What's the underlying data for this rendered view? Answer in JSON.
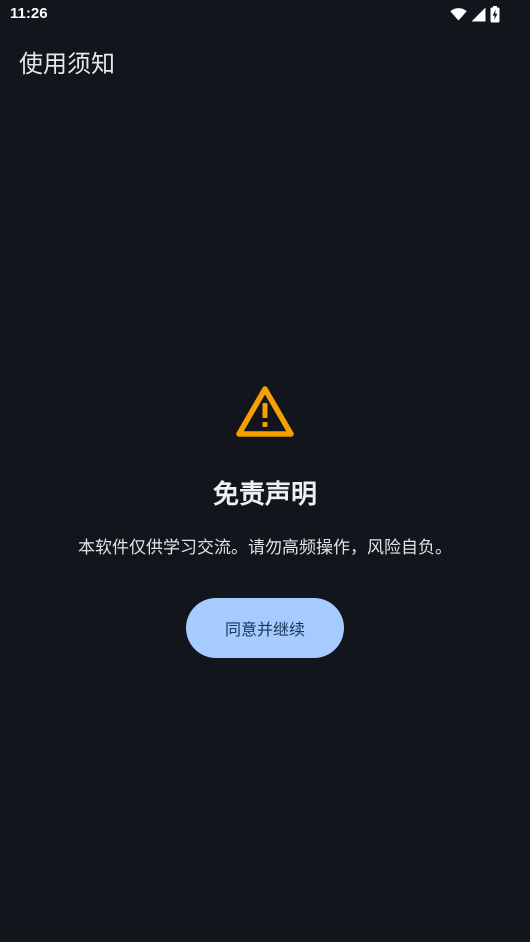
{
  "status_bar": {
    "time": "11:26",
    "icons": [
      "wifi-icon",
      "signal-icon",
      "battery-charging-icon"
    ]
  },
  "app_bar": {
    "title": "使用须知"
  },
  "dialog": {
    "icon": "warning-triangle-icon",
    "icon_color": "#f5a000",
    "title": "免责声明",
    "message": "本软件仅供学习交流。请勿高频操作，风险自负。",
    "button_label": "同意并继续",
    "button_color": "#a6cbff"
  },
  "colors": {
    "background": "#12151b",
    "text": "#e6e8ec"
  }
}
